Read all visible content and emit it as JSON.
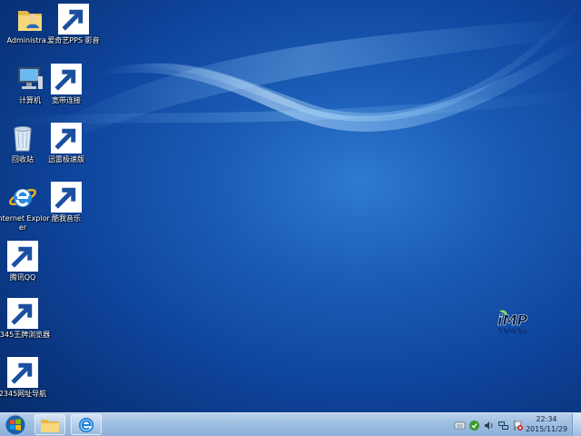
{
  "desktop": {
    "icons": [
      {
        "label": "Administra..."
      },
      {
        "label": "爱奇艺PPS 影音"
      },
      {
        "label": "计算机"
      },
      {
        "label": "宽带连接"
      },
      {
        "label": "回收站"
      },
      {
        "label": "迅雷极速版"
      },
      {
        "label": "Internet Explorer"
      },
      {
        "label": "酷我音乐"
      },
      {
        "label": "腾讯QQ"
      },
      {
        "label": "2345王牌浏览器"
      },
      {
        "label": "2345网址导航"
      }
    ],
    "watermark_text": "iMP"
  },
  "taskbar": {
    "pinned": [
      {
        "icon": "folder-icon"
      },
      {
        "icon": "browser-e-icon"
      }
    ],
    "tray_icons": [
      "keyboard-icon",
      "security-shield-icon",
      "volume-icon",
      "network-icon",
      "flag-icon"
    ],
    "clock": {
      "time": "22:34",
      "date": "2015/11/29"
    }
  }
}
